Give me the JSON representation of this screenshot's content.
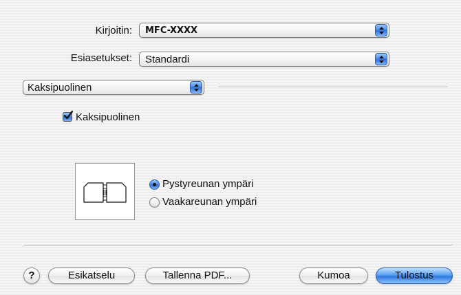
{
  "printer": {
    "label": "Kirjoitin:",
    "value": "MFC-XXXX"
  },
  "presets": {
    "label": "Esiasetukset:",
    "value": "Standardi"
  },
  "panel": {
    "value": "Kaksipuolinen"
  },
  "duplex_checkbox": {
    "label": "Kaksipuolinen",
    "checked": true
  },
  "binding": {
    "options": [
      {
        "label": "Pystyreunan ympäri",
        "selected": true
      },
      {
        "label": "Vaakareunan ympäri",
        "selected": false
      }
    ]
  },
  "buttons": {
    "help": "?",
    "preview": "Esikatselu",
    "save_pdf": "Tallenna PDF...",
    "cancel": "Kumoa",
    "print": "Tulostus"
  },
  "colors": {
    "accent": "#3f86e6"
  },
  "icons": {
    "popup_arrows": "up-down-arrows-icon",
    "binding_preview": "long-edge-binding-icon"
  }
}
